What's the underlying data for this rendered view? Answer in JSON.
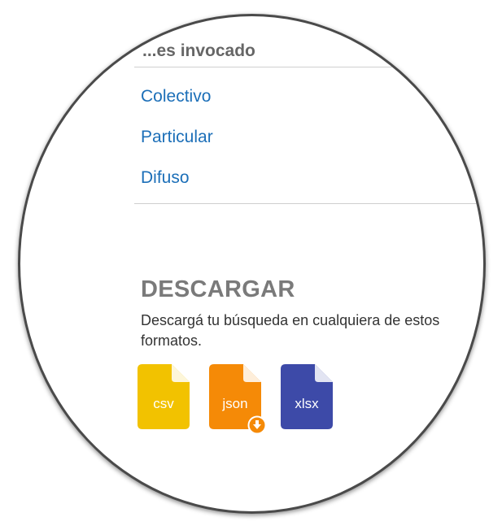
{
  "filters": {
    "partial_heading": "...es invocado",
    "items": [
      {
        "label": "Colectivo"
      },
      {
        "label": "Particular"
      },
      {
        "label": "Difuso"
      }
    ]
  },
  "download": {
    "title": "DESCARGAR",
    "description": "Descargá tu búsqueda en cualquiera de estos formatos.",
    "formats": [
      {
        "label": "csv",
        "color": "#f2c200"
      },
      {
        "label": "json",
        "color": "#f58a07",
        "badge_icon": "download-arrow-icon"
      },
      {
        "label": "xlsx",
        "color": "#3d4aa8"
      }
    ]
  },
  "colors": {
    "link": "#1c6fb8",
    "heading": "#7a7a7a"
  }
}
